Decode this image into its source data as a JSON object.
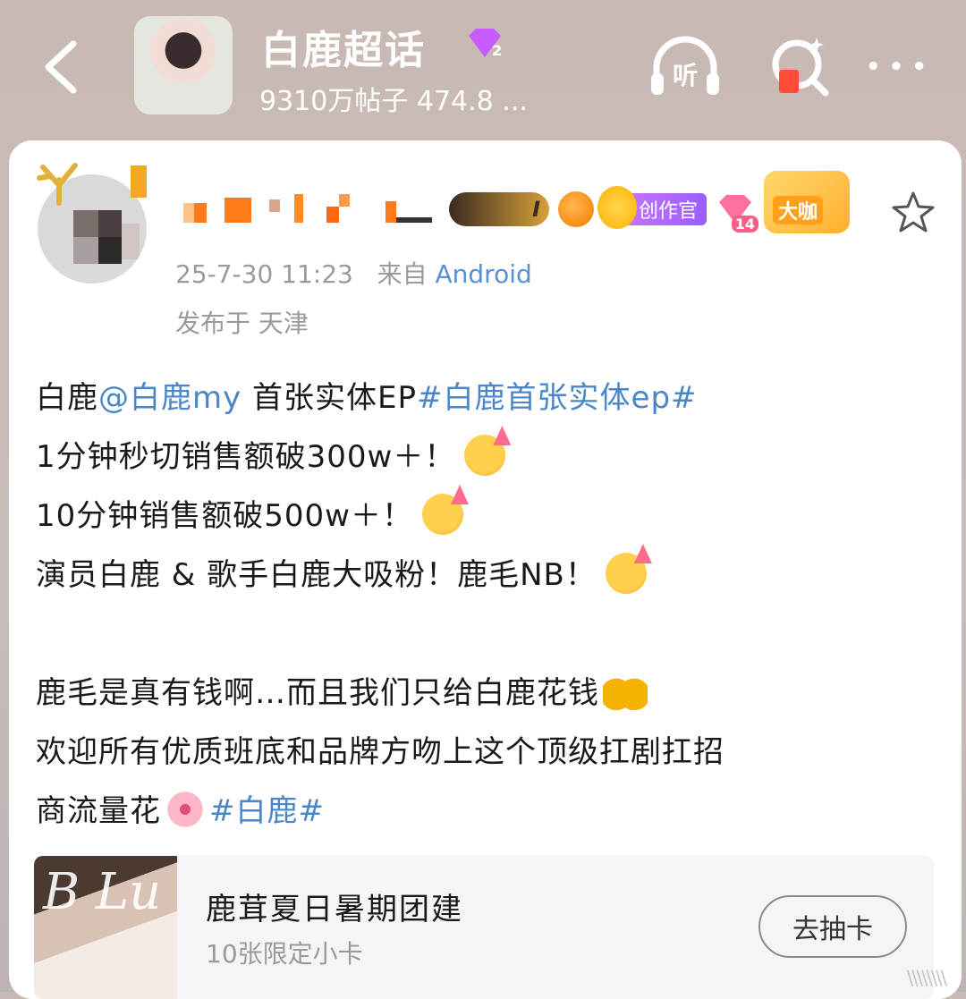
{
  "header": {
    "title": "白鹿超话",
    "level": "2",
    "stats": "9310万帖子 474.8 ...",
    "listen_label": "听",
    "more_label": "• • •"
  },
  "post": {
    "timestamp": "25-7-30 11:23",
    "source_prefix": "来自",
    "source": "Android",
    "location": "发布于 天津",
    "badges": {
      "crown_level": "I",
      "creator_label": "创作官",
      "gem_level": "14",
      "big_label": "大咖"
    },
    "lines": [
      {
        "a": "白鹿",
        "mention": "@白鹿my",
        "b": " 首张实体EP",
        "tag": "#白鹿首张实体ep#"
      },
      {
        "text": "1分钟秒切销售额破300w＋！"
      },
      {
        "text": "10分钟销售额破500w＋！"
      },
      {
        "text": "演员白鹿 & 歌手白鹿大吸粉！鹿毛NB！"
      },
      {
        "text": ""
      },
      {
        "text": "鹿毛是真有钱啊…而且我们只给白鹿花钱"
      },
      {
        "text": "欢迎所有优质班底和品牌方吻上这个顶级扛剧扛招"
      },
      {
        "a": "商流量花",
        "tag": "#白鹿#"
      }
    ]
  },
  "activity": {
    "thumb_text": "B Lu",
    "title": "鹿茸夏日暑期团建",
    "subtitle": "10张限定小卡",
    "button": "去抽卡"
  },
  "watermark": "\\\\\\\\\\\\\\\\"
}
